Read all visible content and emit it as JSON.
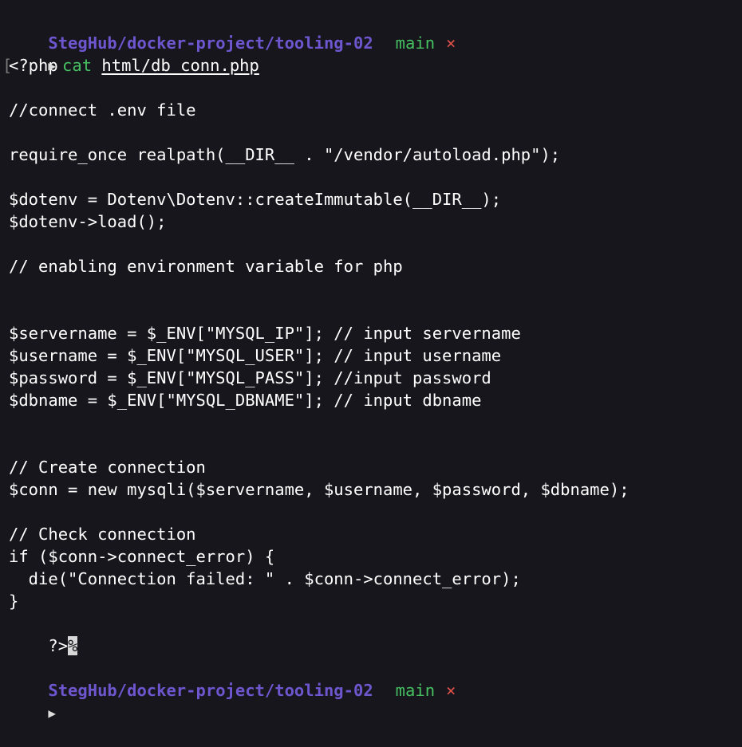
{
  "prompt_top": {
    "path": "StegHub/docker-project/tooling-02",
    "branch": "main",
    "dirty_mark": "×"
  },
  "command": {
    "arrow": "▶",
    "name": "cat",
    "argument": "html/db_conn.php"
  },
  "output_lines": [
    "<?php",
    "",
    "//connect .env file",
    "",
    "require_once realpath(__DIR__ . \"/vendor/autoload.php\");",
    "",
    "$dotenv = Dotenv\\Dotenv::createImmutable(__DIR__);",
    "$dotenv->load();",
    "",
    "// enabling environment variable for php",
    "",
    "",
    "$servername = $_ENV[\"MYSQL_IP\"]; // input servername",
    "$username = $_ENV[\"MYSQL_USER\"]; // input username",
    "$password = $_ENV[\"MYSQL_PASS\"]; //input password",
    "$dbname = $_ENV[\"MYSQL_DBNAME\"]; // input dbname",
    "",
    "",
    "// Create connection",
    "$conn = new mysqli($servername, $username, $password, $dbname);",
    "",
    "// Check connection",
    "if ($conn->connect_error) {",
    "  die(\"Connection failed: \" . $conn->connect_error);",
    "}"
  ],
  "last_output_line": "?>",
  "eof_marker": "%",
  "prompt_bottom": {
    "path": "StegHub/docker-project/tooling-02",
    "branch": "main",
    "dirty_mark": "×"
  },
  "input_prompt": {
    "arrow": "▶"
  },
  "colors": {
    "background": "#16161c",
    "path": "#6e56cf",
    "branch": "#46c060",
    "dirty": "#e2524a",
    "text": "#ffffff"
  }
}
